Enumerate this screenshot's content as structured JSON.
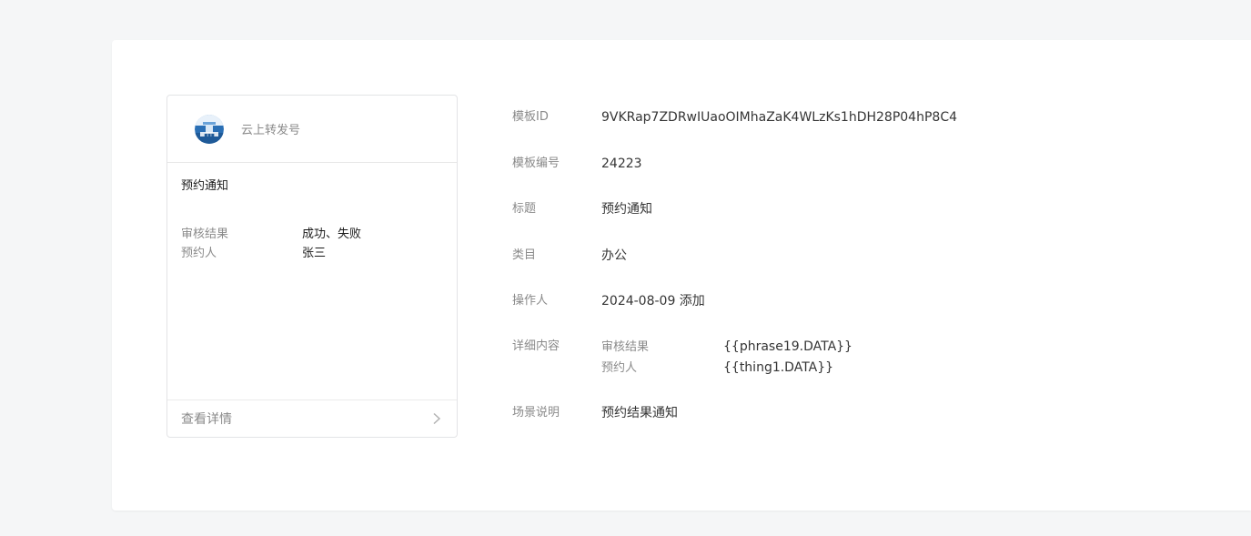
{
  "preview": {
    "account_name": "云上转发号",
    "title": "预约通知",
    "fields": [
      {
        "key": "审核结果",
        "value": "成功、失败"
      },
      {
        "key": "预约人",
        "value": "张三"
      }
    ],
    "footer_label": "查看详情",
    "avatar_icon": "account-avatar-icon",
    "chevron_icon": "chevron-right-icon"
  },
  "details": {
    "template_id": {
      "label": "模板ID",
      "value": "9VKRap7ZDRwIUaoOIMhaZaK4WLzKs1hDH28P04hP8C4"
    },
    "template_no": {
      "label": "模板编号",
      "value": "24223"
    },
    "title": {
      "label": "标题",
      "value": "预约通知"
    },
    "category": {
      "label": "类目",
      "value": "办公"
    },
    "operator": {
      "label": "操作人",
      "value": "2024-08-09 添加"
    },
    "content": {
      "label": "详细内容",
      "rows": [
        {
          "key": "审核结果",
          "value": "{{phrase19.DATA}}"
        },
        {
          "key": "预约人",
          "value": "{{thing1.DATA}}"
        }
      ]
    },
    "scene": {
      "label": "场景说明",
      "value": "预约结果通知"
    }
  },
  "colors": {
    "background": "#f5f6f7",
    "panel": "#ffffff",
    "label_gray": "#8a8a8a",
    "text": "#353535"
  }
}
